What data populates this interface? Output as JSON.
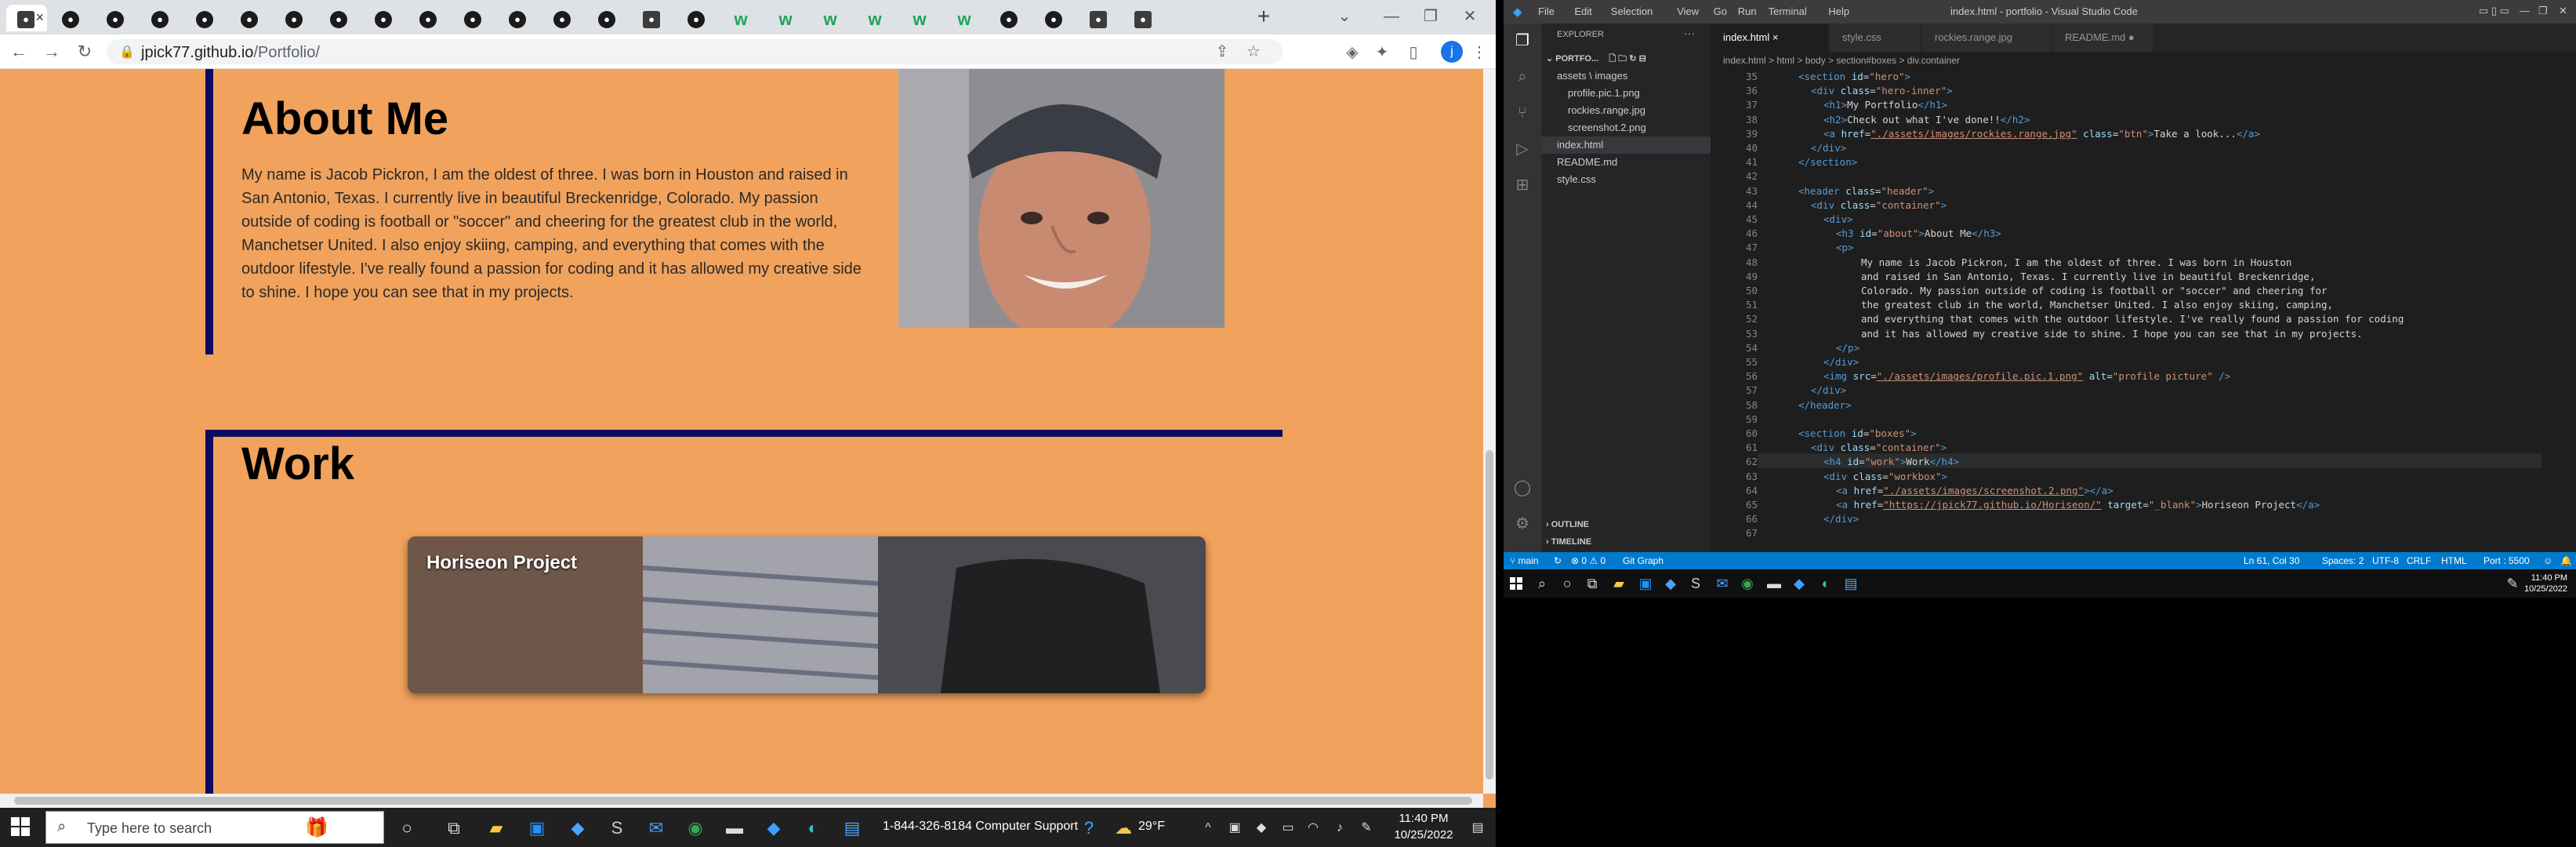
{
  "browser": {
    "tab_count": 26,
    "new_tab_label": "+",
    "url_host": "jpick77.github.io",
    "url_path": "/Portfolio/",
    "profile_initial": "j"
  },
  "portfolio": {
    "about": {
      "title": "About Me",
      "text": "My name is Jacob Pickron, I am the oldest of three. I was born in Houston and raised in San Antonio, Texas. I currently live in beautiful Breckenridge, Colorado. My passion outside of coding is football or \"soccer\" and cheering for the greatest club in the world, Manchetser United. I also enjoy skiing, camping, and everything that comes with the outdoor lifestyle. I've really found a passion for coding and it has allowed my creative side to shine. I hope you can see that in my projects."
    },
    "work": {
      "title": "Work",
      "project_label": "Horiseon Project"
    }
  },
  "vscode": {
    "window_title": "index.html - portfolio - Visual Studio Code",
    "menu": [
      "File",
      "Edit",
      "Selection",
      "View",
      "Go",
      "Run",
      "Terminal",
      "Help"
    ],
    "explorer_label": "EXPLORER",
    "folder_label": "PORTFO...",
    "tree": [
      {
        "label": "assets \\ images",
        "indent": 1
      },
      {
        "label": "profile.pic.1.png",
        "indent": 2
      },
      {
        "label": "rockies.range.jpg",
        "indent": 2
      },
      {
        "label": "screenshot.2.png",
        "indent": 2
      },
      {
        "label": "index.html",
        "indent": 1,
        "selected": true
      },
      {
        "label": "README.md",
        "indent": 1
      },
      {
        "label": "style.css",
        "indent": 1
      }
    ],
    "outline_label": "OUTLINE",
    "timeline_label": "TIMELINE",
    "tabs": [
      "index.html",
      "style.css",
      "rockies.range.jpg",
      "README.md"
    ],
    "breadcrumbs": "index.html > html > body > section#boxes > div.container",
    "status": {
      "branch": "main",
      "problems": "⊗ 0 ⚠ 0",
      "git_graph": "Git Graph",
      "position": "Ln 61, Col 30",
      "spaces": "Spaces: 2",
      "encoding": "UTF-8",
      "eol": "CRLF",
      "language": "HTML",
      "port": "Port : 5500"
    },
    "lines": [
      {
        "n": "35",
        "i": 2,
        "h": "<span class=\"tag\">&lt;section</span> <span class=\"attr\">id</span>=<span class=\"str\">\"hero\"</span><span class=\"tag\">&gt;</span>"
      },
      {
        "n": "36",
        "i": 3,
        "h": "<span class=\"tag\">&lt;div</span> <span class=\"attr\">class</span>=<span class=\"str\">\"hero-inner\"</span><span class=\"tag\">&gt;</span>"
      },
      {
        "n": "37",
        "i": 4,
        "h": "<span class=\"tag\">&lt;h1&gt;</span>My Portfolio<span class=\"tag\">&lt;/h1&gt;</span>"
      },
      {
        "n": "38",
        "i": 4,
        "h": "<span class=\"tag\">&lt;h2&gt;</span>Check out what I've done!!<span class=\"tag\">&lt;/h2&gt;</span>"
      },
      {
        "n": "39",
        "i": 4,
        "h": "<span class=\"tag\">&lt;a</span> <span class=\"attr\">href</span>=<span class=\"lnk\">\"./assets/images/rockies.range.jpg\"</span> <span class=\"attr\">class</span>=<span class=\"str\">\"btn\"</span><span class=\"tag\">&gt;</span>Take a look...<span class=\"tag\">&lt;/a&gt;</span>"
      },
      {
        "n": "40",
        "i": 3,
        "h": "<span class=\"tag\">&lt;/div&gt;</span>"
      },
      {
        "n": "41",
        "i": 2,
        "h": "<span class=\"tag\">&lt;/section&gt;</span>"
      },
      {
        "n": "42",
        "i": 0,
        "h": ""
      },
      {
        "n": "43",
        "i": 2,
        "h": "<span class=\"tag\">&lt;header</span> <span class=\"attr\">class</span>=<span class=\"str\">\"header\"</span><span class=\"tag\">&gt;</span>"
      },
      {
        "n": "44",
        "i": 3,
        "h": "<span class=\"tag\">&lt;div</span> <span class=\"attr\">class</span>=<span class=\"str\">\"container\"</span><span class=\"tag\">&gt;</span>"
      },
      {
        "n": "45",
        "i": 4,
        "h": "<span class=\"tag\">&lt;div&gt;</span>"
      },
      {
        "n": "46",
        "i": 5,
        "h": "<span class=\"tag\">&lt;h3</span> <span class=\"attr\">id</span>=<span class=\"str\">\"about\"</span><span class=\"tag\">&gt;</span>About Me<span class=\"tag\">&lt;/h3&gt;</span>"
      },
      {
        "n": "47",
        "i": 5,
        "h": "<span class=\"tag\">&lt;p&gt;</span>"
      },
      {
        "n": "48",
        "i": 7,
        "h": "My name is Jacob Pickron, I am the oldest of three. I was born in Houston"
      },
      {
        "n": "49",
        "i": 7,
        "h": "and raised in San Antonio, Texas. I currently live in beautiful Breckenridge,"
      },
      {
        "n": "50",
        "i": 7,
        "h": "Colorado. My passion outside of coding is football or \"soccer\" and cheering for"
      },
      {
        "n": "51",
        "i": 7,
        "h": "the greatest club in the world, Manchetser United. I also enjoy skiing, camping,"
      },
      {
        "n": "52",
        "i": 7,
        "h": "and everything that comes with the outdoor lifestyle. I've really found a passion for coding"
      },
      {
        "n": "53",
        "i": 7,
        "h": "and it has allowed my creative side to shine. I hope you can see that in my projects."
      },
      {
        "n": "54",
        "i": 5,
        "h": "<span class=\"tag\">&lt;/p&gt;</span>"
      },
      {
        "n": "55",
        "i": 4,
        "h": "<span class=\"tag\">&lt;/div&gt;</span>"
      },
      {
        "n": "56",
        "i": 4,
        "h": "<span class=\"tag\">&lt;img</span> <span class=\"attr\">src</span>=<span class=\"lnk\">\"./assets/images/profile.pic.1.png\"</span> <span class=\"attr\">alt</span>=<span class=\"str\">\"profile picture\"</span> <span class=\"tag\">/&gt;</span>"
      },
      {
        "n": "57",
        "i": 3,
        "h": "<span class=\"tag\">&lt;/div&gt;</span>"
      },
      {
        "n": "58",
        "i": 2,
        "h": "<span class=\"tag\">&lt;/header&gt;</span>"
      },
      {
        "n": "59",
        "i": 0,
        "h": ""
      },
      {
        "n": "60",
        "i": 2,
        "h": "<span class=\"tag\">&lt;section</span> <span class=\"attr\">id</span>=<span class=\"str\">\"boxes\"</span><span class=\"tag\">&gt;</span>"
      },
      {
        "n": "61",
        "i": 3,
        "h": "<span class=\"tag\">&lt;div</span> <span class=\"attr\">class</span>=<span class=\"str\">\"container\"</span><span class=\"tag\">&gt;</span>"
      },
      {
        "n": "62",
        "i": 4,
        "h": "<span class=\"tag\">&lt;h4</span> <span class=\"attr\">id</span>=<span class=\"str\">\"work\"</span><span class=\"tag\">&gt;</span>Work<span class=\"tag\">&lt;/h4&gt;</span>"
      },
      {
        "n": "63",
        "i": 4,
        "h": "<span class=\"tag\">&lt;div</span> <span class=\"attr\">class</span>=<span class=\"str\">\"workbox\"</span><span class=\"tag\">&gt;</span>"
      },
      {
        "n": "64",
        "i": 5,
        "h": "<span class=\"tag\">&lt;a</span> <span class=\"attr\">href</span>=<span class=\"lnk\">\"./assets/images/screenshot.2.png\"</span><span class=\"tag\">&gt;&lt;/a&gt;</span>"
      },
      {
        "n": "65",
        "i": 5,
        "h": "<span class=\"tag\">&lt;a</span> <span class=\"attr\">href</span>=<span class=\"lnk\">\"https://jpick77.github.io/Horiseon/\"</span> <span class=\"attr\">target</span>=<span class=\"str\">\"_blank\"</span><span class=\"tag\">&gt;</span>Horiseon Project<span class=\"tag\">&lt;/a&gt;</span>"
      },
      {
        "n": "66",
        "i": 4,
        "h": "<span class=\"tag\">&lt;/div&gt;</span>"
      },
      {
        "n": "67",
        "i": 0,
        "h": ""
      }
    ],
    "clock_time": "11:40 PM",
    "clock_date": "10/25/2022"
  },
  "taskbar": {
    "search_placeholder": "Type here to search",
    "support_text": "1-844-326-8184 Computer Support",
    "weather": "29°F",
    "time": "11:40 PM",
    "date": "10/25/2022"
  },
  "colors": {
    "page_bg": "#f1a25c",
    "accent_bar": "#0a0a5e",
    "vscode_status": "#007acc"
  }
}
